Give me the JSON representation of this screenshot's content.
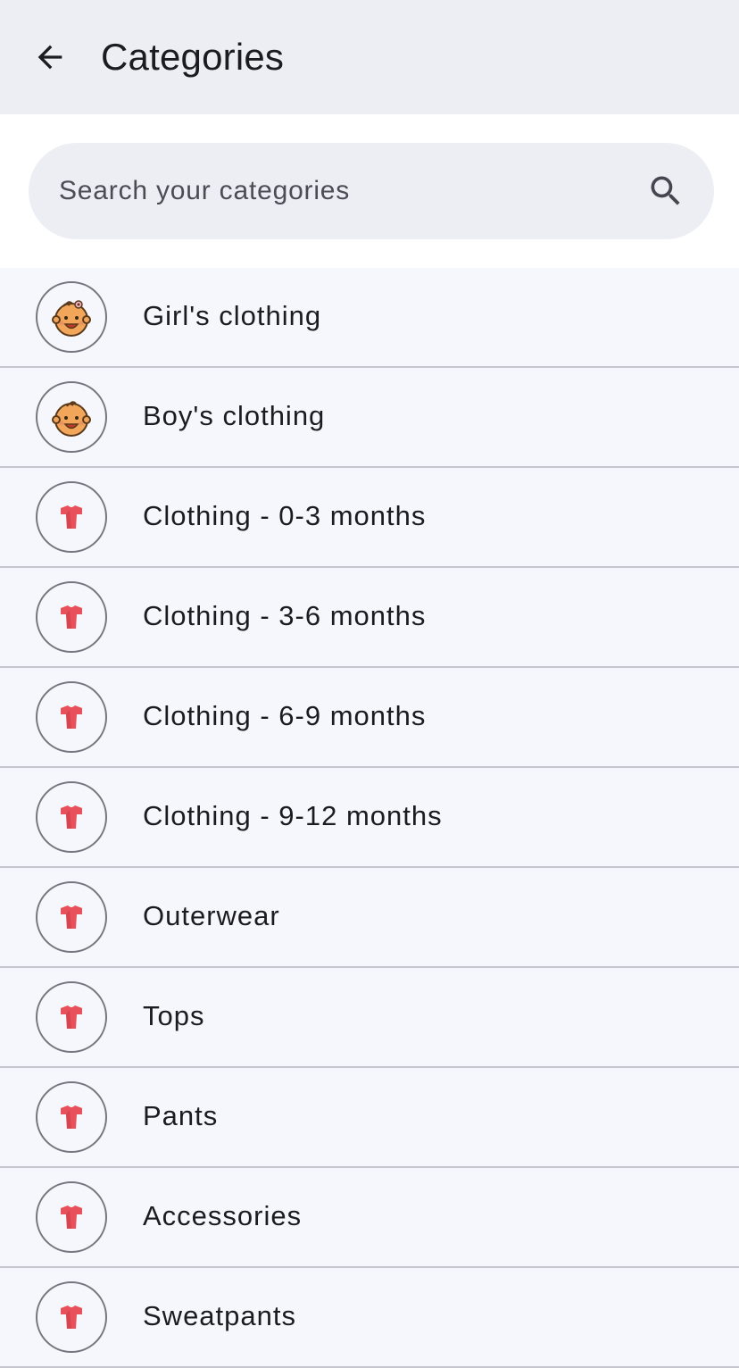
{
  "header": {
    "title": "Categories",
    "background": "#eceef3"
  },
  "search": {
    "placeholder": "Search your categories",
    "value": ""
  },
  "colors": {
    "list_background": "#f6f7fc",
    "divider": "#c4c6cf",
    "shirt_icon": "#e8505b",
    "baby_face": "#f2a65a"
  },
  "categories": [
    {
      "label": "Girl's clothing",
      "icon": "baby-girl-icon"
    },
    {
      "label": "Boy's clothing",
      "icon": "baby-boy-icon"
    },
    {
      "label": "Clothing - 0-3 months",
      "icon": "shirt-icon"
    },
    {
      "label": "Clothing - 3-6 months",
      "icon": "shirt-icon"
    },
    {
      "label": "Clothing - 6-9 months",
      "icon": "shirt-icon"
    },
    {
      "label": "Clothing - 9-12 months",
      "icon": "shirt-icon"
    },
    {
      "label": "Outerwear",
      "icon": "shirt-icon"
    },
    {
      "label": "Tops",
      "icon": "shirt-icon"
    },
    {
      "label": "Pants",
      "icon": "shirt-icon"
    },
    {
      "label": "Accessories",
      "icon": "shirt-icon"
    },
    {
      "label": "Sweatpants",
      "icon": "shirt-icon"
    }
  ]
}
